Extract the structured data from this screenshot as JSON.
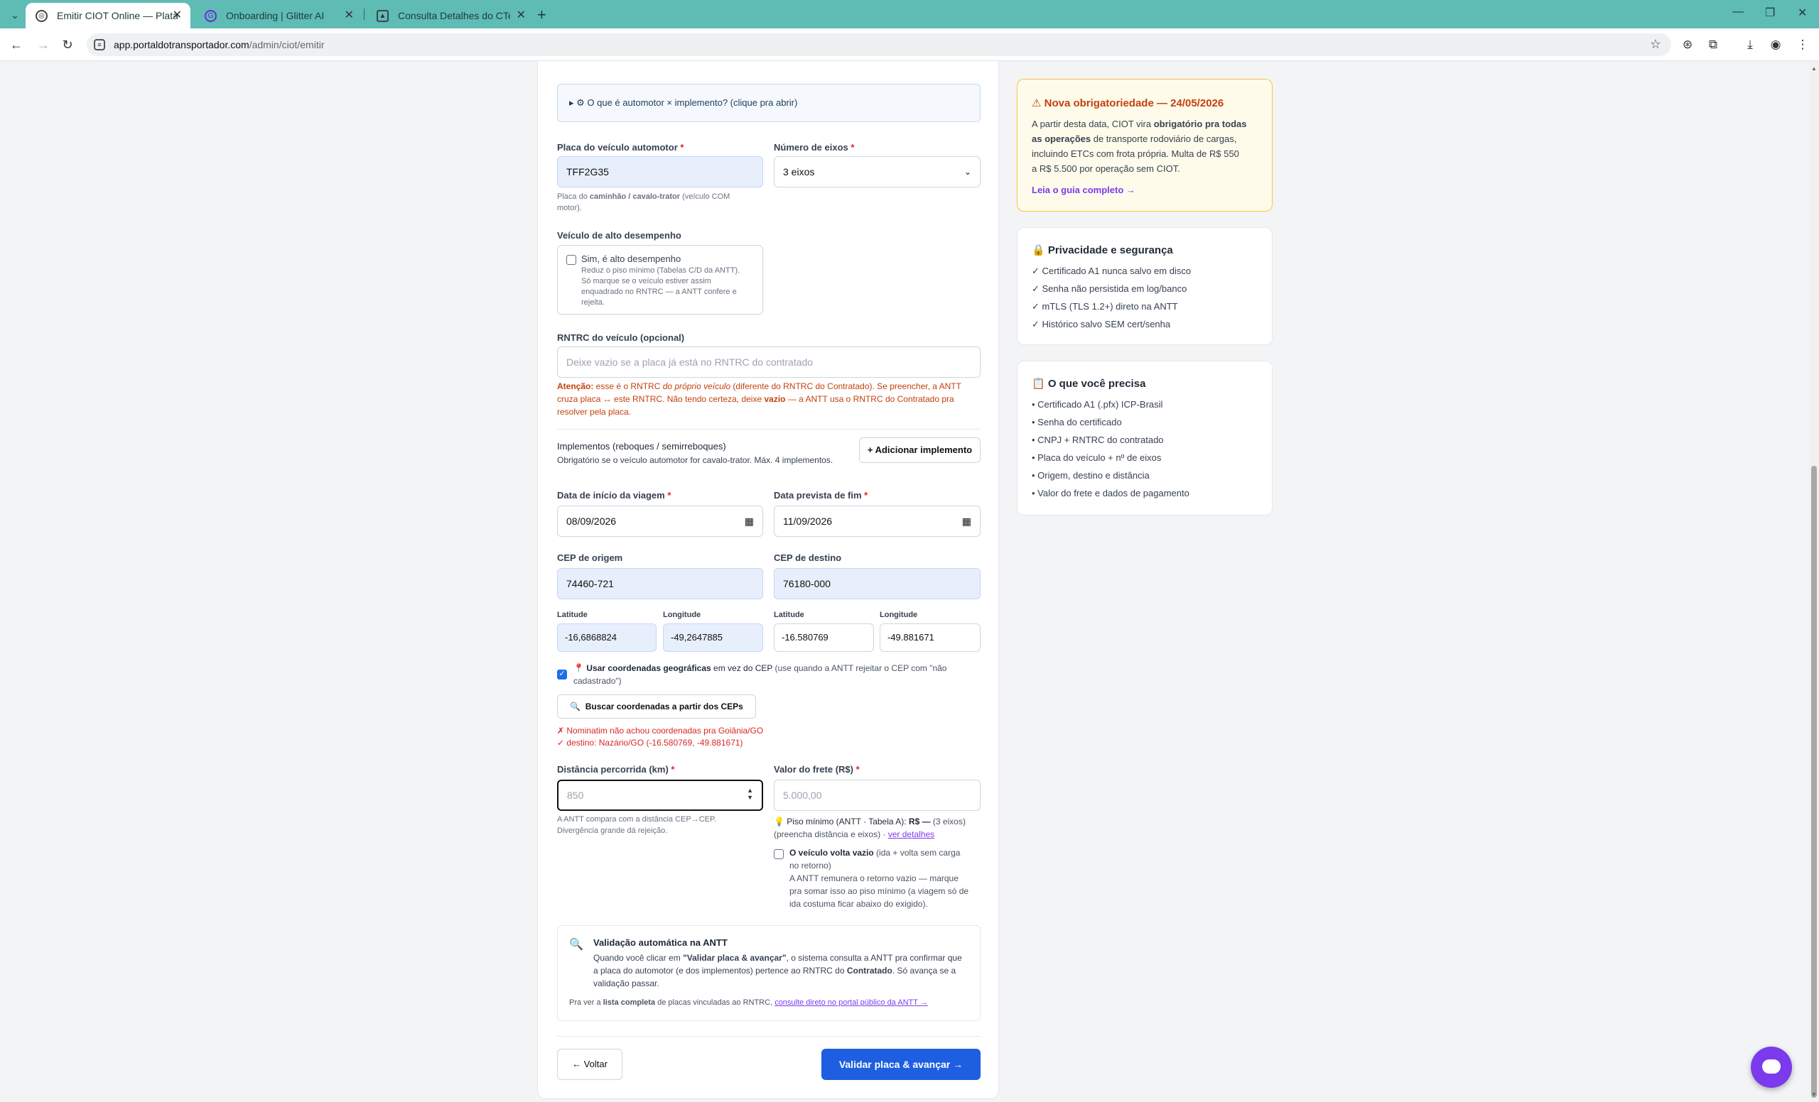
{
  "browser": {
    "tabs": [
      {
        "title": "Emitir CIOT Online — Plataforma",
        "active": true
      },
      {
        "title": "Onboarding | Glitter AI",
        "active": false
      },
      {
        "title": "Consulta Detalhes do CTe - ERP",
        "active": false
      }
    ],
    "url_host": "app.portaldotransportador.com",
    "url_path": "/admin/ciot/emitir"
  },
  "form": {
    "accordion_label": "▸ ⚙ O que é automotor × implemento? (clique pra abrir)",
    "placa": {
      "label": "Placa do veículo automotor",
      "value": "TFF2G35",
      "help_prefix": "Placa do ",
      "help_bold": "caminhão / cavalo-trator",
      "help_suffix": " (veículo COM",
      "help_line2": "motor)."
    },
    "eixos": {
      "label": "Número de eixos",
      "value": "3 eixos"
    },
    "alto_desempenho": {
      "label": "Veículo de alto desempenho",
      "checkbox_label": "Sim, é alto desempenho",
      "desc_lines": [
        "Reduz o piso mínimo (Tabelas C/D da ANTT).",
        "Só marque se o veículo estiver assim",
        "enquadrado no RNTRC — a ANTT confere e",
        "rejeita."
      ]
    },
    "rntrc": {
      "label": "RNTRC do veículo (opcional)",
      "placeholder": "Deixe vazio se a placa já está no RNTRC do contratado",
      "warn_bold": "Atenção:",
      "warn_a": " esse é o RNTRC ",
      "warn_italic": "do próprio veículo",
      "warn_b": " (diferente do RNTRC do Contratado). Se preencher, a ANTT",
      "warn_line2a": "cruza placa ↔ este RNTRC. Não tendo certeza, deixe ",
      "warn_bold2": "vazio",
      "warn_line2b": " — a ANTT usa o RNTRC do Contratado pra",
      "warn_line3": "resolver pela placa."
    },
    "implementos": {
      "title": "Implementos (reboques / semirreboques)",
      "desc": "Obrigatório se o veículo automotor for cavalo-trator. Máx. 4 implementos.",
      "add_button": "+ Adicionar implemento"
    },
    "data_inicio": {
      "label": "Data de início da viagem",
      "value": "08/09/2026"
    },
    "data_fim": {
      "label": "Data prevista de fim",
      "value": "11/09/2026"
    },
    "cep_origem": {
      "label": "CEP de origem",
      "value": "74460-721"
    },
    "cep_destino": {
      "label": "CEP de destino",
      "value": "76180-000"
    },
    "coords": {
      "lat_label": "Latitude",
      "lon_label": "Longitude",
      "origem_lat": "-16,6868824",
      "origem_lon": "-49,2647885",
      "destino_lat": "-16.580769",
      "destino_lon": "-49.881671"
    },
    "usar_coords": {
      "bold": "Usar coordenadas geográficas",
      "text_a": " em vez do CEP ",
      "text_b": "(use quando a ANTT rejeitar o CEP com \"não",
      "text_line2": "cadastrado\")"
    },
    "buscar_button": "Buscar coordenadas a partir dos CEPs",
    "status_err": "✗ Nominatim não achou coordenadas pra Goiânia/GO",
    "status_ok": "✓ destino: Nazário/GO (-16.580769, -49.881671)",
    "distancia": {
      "label": "Distância percorrida (km)",
      "placeholder": "850",
      "help_line1": "A ANTT compara com a distância CEP→CEP.",
      "help_line2": "Divergência grande dá rejeição."
    },
    "frete": {
      "label": "Valor do frete (R$)",
      "placeholder": "5.000,00",
      "piso_a": "Piso mínimo (ANTT · Tabela A): ",
      "piso_bold": "R$ —",
      "piso_b": " (3 eixos)",
      "piso_line2": "(preencha distância e eixos) · ",
      "piso_link": "ver detalhes"
    },
    "volta_vazio": {
      "bold": "O veículo volta vazio",
      "text": " (ida + volta sem carga",
      "line2": "no retorno)",
      "desc_lines": [
        "A ANTT remunera o retorno vazio — marque",
        "pra somar isso ao piso mínimo (a viagem só de",
        "ida costuma ficar abaixo do exigido)."
      ]
    },
    "validacao": {
      "title": "Validação automática na ANTT",
      "line1a": "Quando você clicar em ",
      "line1b": "\"Validar placa & avançar\"",
      "line1c": ", o sistema consulta a ANTT pra confirmar que",
      "line2a": "a placa do automotor (e dos implementos) pertence ao RNTRC do ",
      "line2b": "Contratado",
      "line2c": ". Só avança se a",
      "line3": "validação passar.",
      "footer_a": "Pra ver a ",
      "footer_bold": "lista completa",
      "footer_b": " de placas vinculadas ao RNTRC, ",
      "footer_link": "consulte direto no portal público da ANTT →"
    },
    "voltar_button": "← Voltar",
    "avancar_button": "Validar placa & avançar →"
  },
  "sidebar": {
    "alert": {
      "title": "⚠ Nova obrigatoriedade — 24/05/2026",
      "line1": "A partir desta data, CIOT vira ",
      "line1_bold": "obrigatório pra todas",
      "line2_bold": "as operações",
      "line2": " de transporte rodoviário de cargas,",
      "line3": "incluindo ETCs com frota própria. Multa de R$ 550",
      "line4": "a R$ 5.500 por operação sem CIOT.",
      "link": "Leia o guia completo →"
    },
    "privacy": {
      "title": "🔒 Privacidade e segurança",
      "items": [
        "✓ Certificado A1 nunca salvo em disco",
        "✓ Senha não persistida em log/banco",
        "✓ mTLS (TLS 1.2+) direto na ANTT",
        "✓ Histórico salvo SEM cert/senha"
      ]
    },
    "needs": {
      "title": "📋 O que você precisa",
      "items": [
        "• Certificado A1 (.pfx) ICP-Brasil",
        "• Senha do certificado",
        "• CNPJ + RNTRC do contratado",
        "• Placa do veículo + nº de eixos",
        "• Origem, destino e distância",
        "• Valor do frete e dados de pagamento"
      ]
    }
  }
}
